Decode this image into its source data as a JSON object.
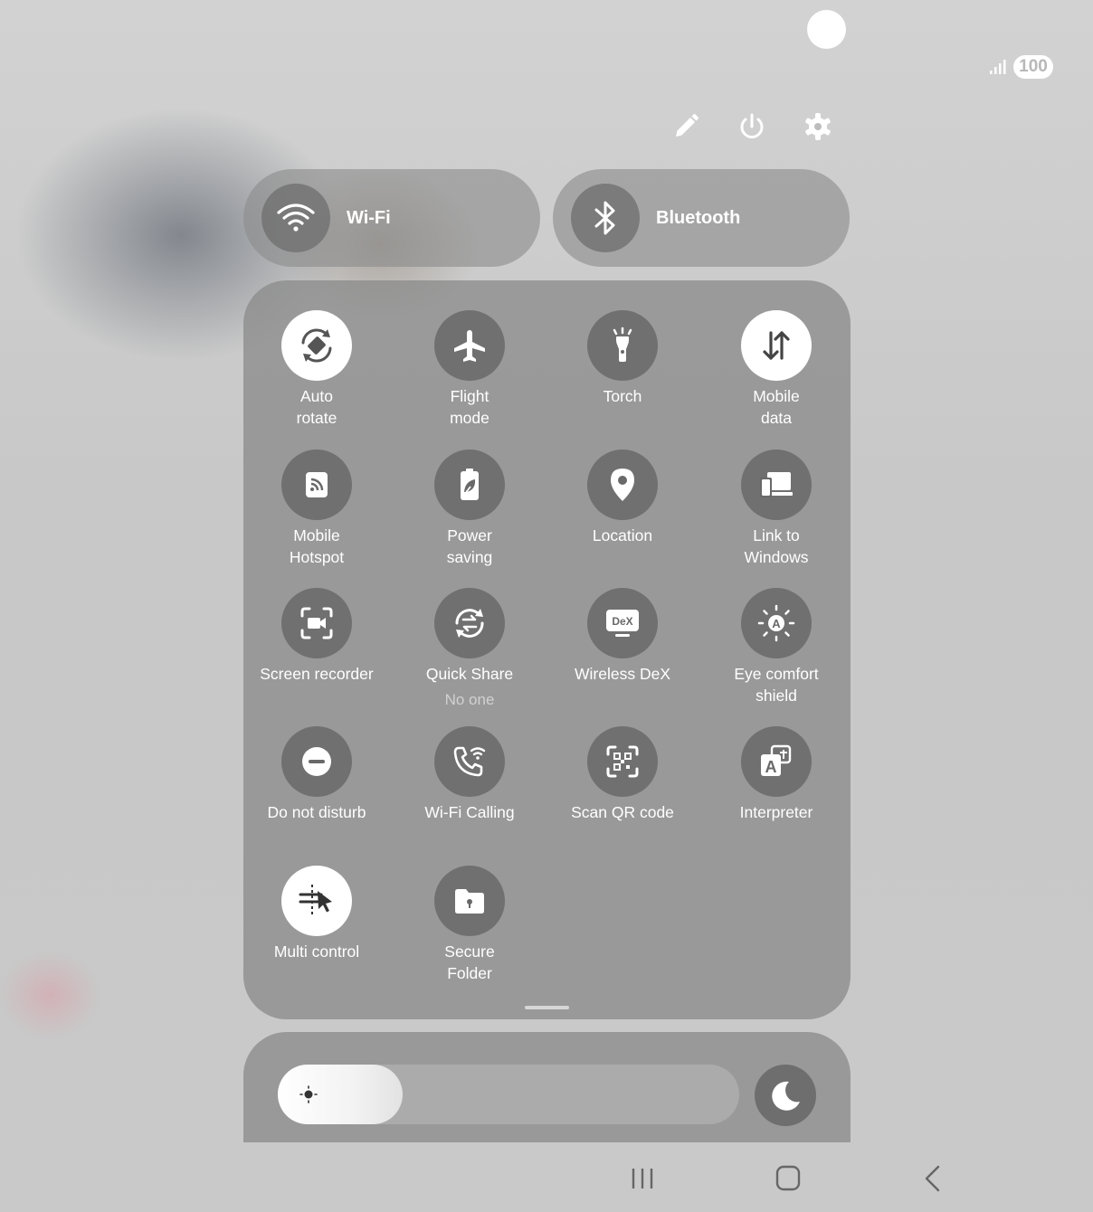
{
  "status_bar": {
    "battery": "100"
  },
  "toggles": {
    "wifi": {
      "label": "Wi-Fi",
      "icon": "wifi-icon"
    },
    "bluetooth": {
      "label": "Bluetooth",
      "icon": "bluetooth-icon"
    }
  },
  "tiles": [
    {
      "label": "Auto\nrotate",
      "icon": "auto-rotate-icon",
      "active": true
    },
    {
      "label": "Flight\nmode",
      "icon": "airplane-icon",
      "active": false
    },
    {
      "label": "Torch",
      "icon": "torch-icon",
      "active": false
    },
    {
      "label": "Mobile\ndata",
      "icon": "mobile-data-icon",
      "active": true
    },
    {
      "label": "Mobile\nHotspot",
      "icon": "hotspot-icon",
      "active": false
    },
    {
      "label": "Power\nsaving",
      "icon": "power-saving-icon",
      "active": false
    },
    {
      "label": "Location",
      "icon": "location-icon",
      "active": false
    },
    {
      "label": "Link to\nWindows",
      "icon": "link-to-windows-icon",
      "active": false
    },
    {
      "label": "Screen recorder",
      "icon": "screen-recorder-icon",
      "active": false
    },
    {
      "label": "Quick Share",
      "sublabel": "No one",
      "icon": "quick-share-icon",
      "active": false
    },
    {
      "label": "Wireless DeX",
      "icon": "dex-icon",
      "active": false
    },
    {
      "label": "Eye comfort\nshield",
      "icon": "eye-comfort-icon",
      "active": false
    },
    {
      "label": "Do not disturb",
      "icon": "do-not-disturb-icon",
      "active": false
    },
    {
      "label": "Wi-Fi Calling",
      "icon": "wifi-calling-icon",
      "active": false
    },
    {
      "label": "Scan QR code",
      "icon": "qr-code-icon",
      "active": false
    },
    {
      "label": "Interpreter",
      "icon": "interpreter-icon",
      "active": false
    },
    {
      "label": "Multi control",
      "icon": "multi-control-icon",
      "active": true
    },
    {
      "label": "Secure\nFolder",
      "icon": "secure-folder-icon",
      "active": false
    }
  ],
  "brightness": {
    "level_percent": 27
  },
  "colors": {
    "tile_bg": "#8c8c8c",
    "tile_icon_off": "#696969",
    "tile_icon_on": "#ffffff",
    "text": "#ffffff"
  }
}
